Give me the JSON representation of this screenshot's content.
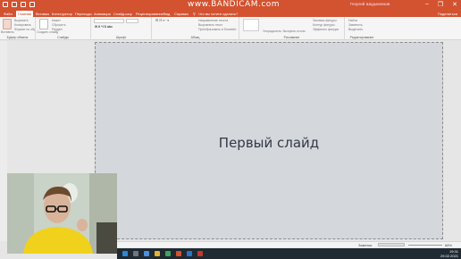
{
  "titlebar": {
    "watermark": "www.BANDICAM.com",
    "user": "Георгий Шадыненков",
    "min": "–",
    "max": "❐",
    "close": "✕"
  },
  "tabs": [
    {
      "label": "Файл",
      "active": false
    },
    {
      "label": "Главная",
      "active": true
    },
    {
      "label": "Вставка",
      "active": false
    },
    {
      "label": "Конструктор",
      "active": false
    },
    {
      "label": "Переходы",
      "active": false
    },
    {
      "label": "Анимация",
      "active": false
    },
    {
      "label": "Слайд-шоу",
      "active": false
    },
    {
      "label": "Рецензирование",
      "active": false
    },
    {
      "label": "Вид",
      "active": false
    },
    {
      "label": "Справка",
      "active": false
    }
  ],
  "search": "Что вы хотите сделать?",
  "share": "Поделиться",
  "ribbon": {
    "clipboard": {
      "label": "Буфер обмена",
      "paste": "Вставить",
      "cut": "Вырезать",
      "copy": "Копировать",
      "format": "Формат по образцу"
    },
    "slides": {
      "label": "Слайды",
      "new": "Создать слайд",
      "layout": "Макет",
      "reset": "Сбросить",
      "section": "Раздел"
    },
    "font": {
      "label": "Шрифт"
    },
    "paragraph": {
      "label": "Абзац",
      "dir": "Направление текста",
      "align": "Выровнять текст",
      "smart": "Преобразовать в SmartArt"
    },
    "drawing": {
      "label": "Рисование",
      "arrange": "Упорядочить",
      "styles": "Экспресс-стили",
      "fill": "Заливка фигуры",
      "outline": "Контур фигуры",
      "effects": "Эффекты фигуры"
    },
    "editing": {
      "label": "Редактирование",
      "find": "Найти",
      "replace": "Заменить",
      "select": "Выделить"
    }
  },
  "slide": {
    "title": "Первый слайд"
  },
  "statusbar": {
    "notes": "Заметки",
    "zoom": "68%"
  },
  "taskbar": {
    "time": "19:31",
    "date": "29.02.2021"
  }
}
